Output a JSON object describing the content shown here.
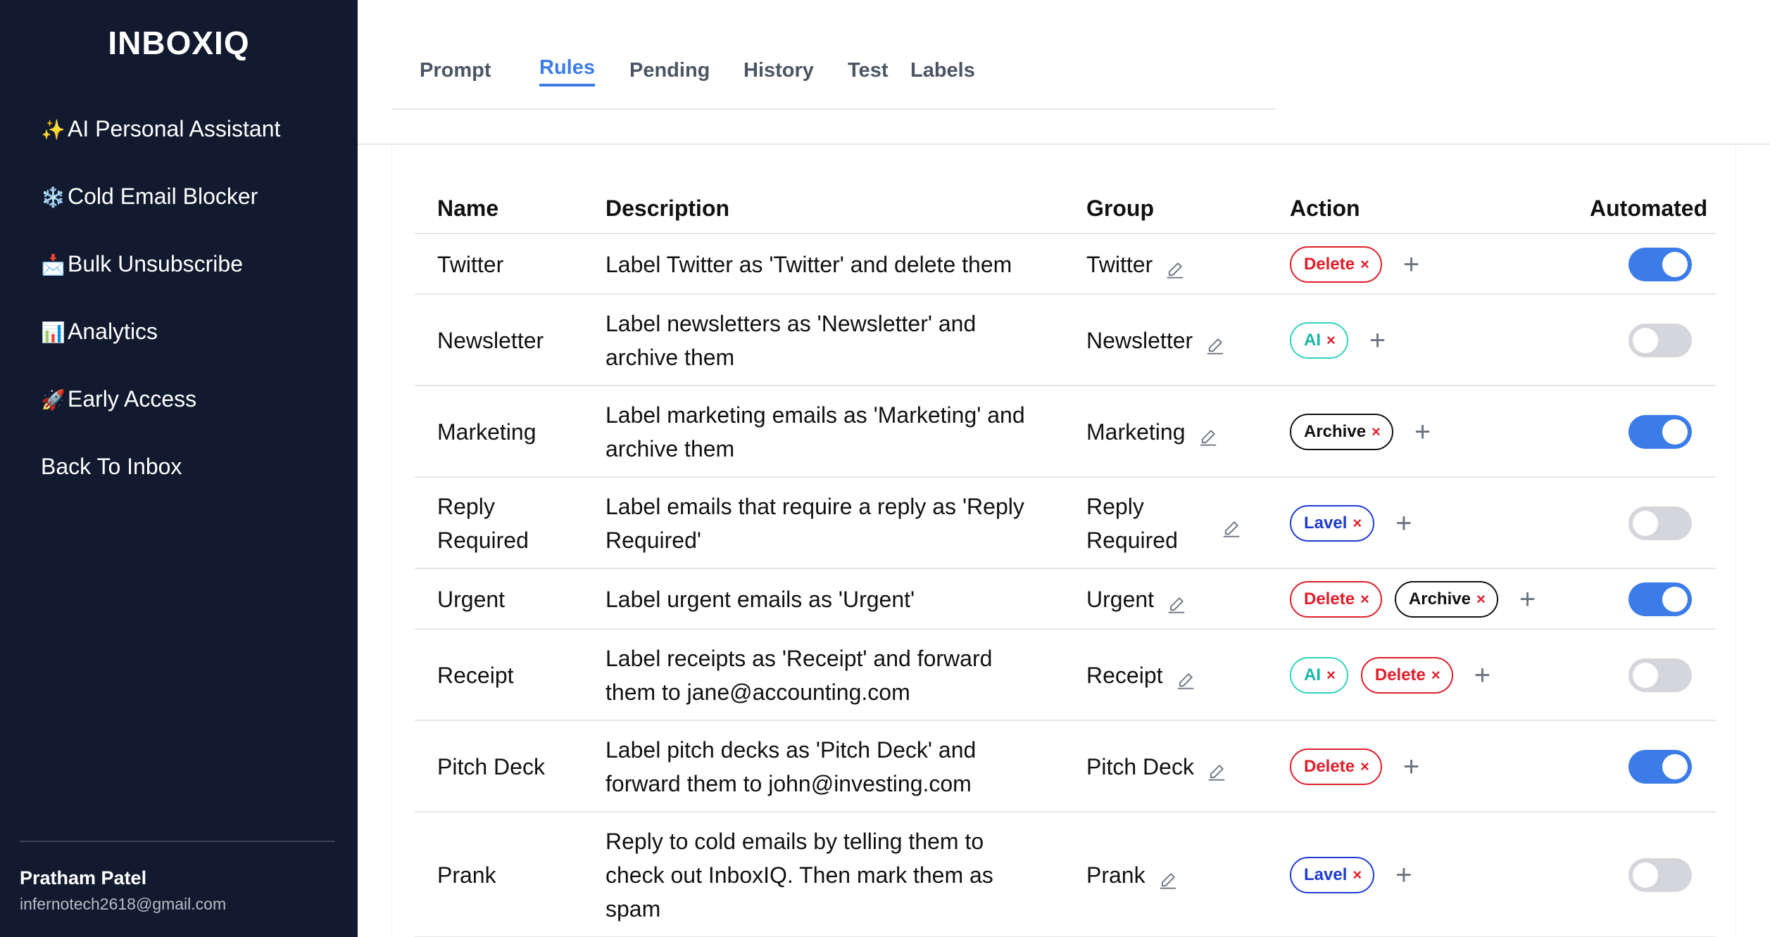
{
  "app": {
    "title": "INBOXIQ"
  },
  "sidebar": {
    "items": [
      {
        "icon": "✨",
        "label": "AI Personal Assistant"
      },
      {
        "icon": "❄️",
        "label": "Cold Email Blocker"
      },
      {
        "icon": "📩",
        "label": "Bulk Unsubscribe"
      },
      {
        "icon": "📊",
        "label": "Analytics"
      },
      {
        "icon": "🚀",
        "label": "Early Access"
      },
      {
        "icon": "",
        "label": "Back To Inbox"
      }
    ],
    "user": {
      "name": "Pratham Patel",
      "email": "infernotech2618@gmail.com"
    }
  },
  "tabs": [
    {
      "label": "Prompt",
      "active": false
    },
    {
      "label": "Rules",
      "active": true
    },
    {
      "label": "Pending",
      "active": false
    },
    {
      "label": "History",
      "active": false
    },
    {
      "label": "Test",
      "active": false
    },
    {
      "label": "Labels",
      "active": false
    }
  ],
  "table": {
    "headers": {
      "name": "Name",
      "description": "Description",
      "group": "Group",
      "action": "Action",
      "automated": "Automated"
    },
    "rows": [
      {
        "name": "Twitter",
        "description": "Label Twitter as 'Twitter' and delete them",
        "group": "Twitter",
        "actions": [
          "Delete"
        ],
        "automated": true
      },
      {
        "name": "Newsletter",
        "description": "Label newsletters as 'Newsletter' and archive them",
        "group": "Newsletter",
        "actions": [
          "AI"
        ],
        "automated": false
      },
      {
        "name": "Marketing",
        "description": "Label marketing emails as 'Marketing' and archive them",
        "group": "Marketing",
        "actions": [
          "Archive"
        ],
        "automated": true
      },
      {
        "name": "Reply Required",
        "description": "Label emails that require a reply as 'Reply Required'",
        "group": "Reply Required",
        "actions": [
          "Lavel"
        ],
        "automated": false
      },
      {
        "name": "Urgent",
        "description": "Label urgent emails as 'Urgent'",
        "group": "Urgent",
        "actions": [
          "Delete",
          "Archive"
        ],
        "automated": true
      },
      {
        "name": "Receipt",
        "description": "Label receipts as 'Receipt' and forward them to jane@accounting.com",
        "group": "Receipt",
        "actions": [
          "AI",
          "Delete"
        ],
        "automated": false
      },
      {
        "name": "Pitch Deck",
        "description": "Label pitch decks as 'Pitch Deck' and forward them to john@investing.com",
        "group": "Pitch Deck",
        "actions": [
          "Delete"
        ],
        "automated": true
      },
      {
        "name": "Prank",
        "description": "Reply to cold emails by telling them to check out InboxIQ. Then mark them as spam",
        "group": "Prank",
        "actions": [
          "Lavel"
        ],
        "automated": false
      }
    ]
  },
  "colors": {
    "sidebar_bg": "#111a2e",
    "accent": "#3b7ce8",
    "delete": "#e11d2a",
    "ai": "#14b8a6",
    "lavel": "#1e3bd1"
  },
  "icons": {
    "edit": "pencil-icon",
    "add": "plus-icon",
    "remove": "close-icon"
  }
}
